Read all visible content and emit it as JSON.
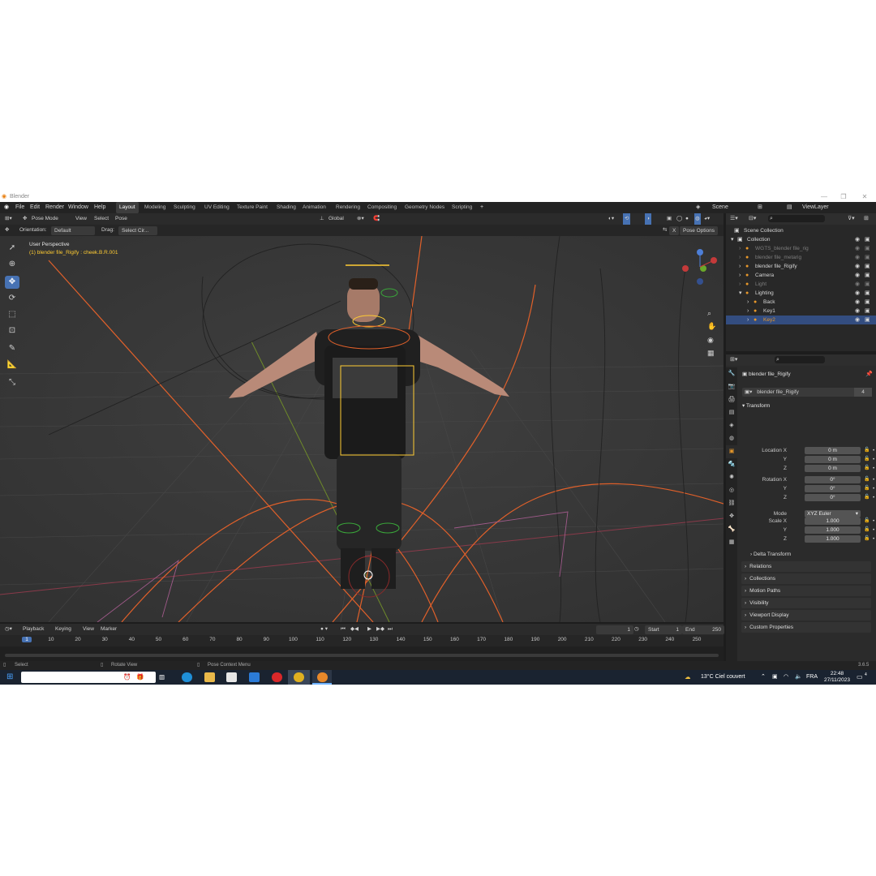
{
  "window": {
    "title": "Blender"
  },
  "menu": {
    "items": [
      "File",
      "Edit",
      "Render",
      "Window",
      "Help"
    ],
    "workspaces": [
      "Layout",
      "Modeling",
      "Sculpting",
      "UV Editing",
      "Texture Paint",
      "Shading",
      "Animation",
      "Rendering",
      "Compositing",
      "Geometry Nodes",
      "Scripting"
    ],
    "add_tab": "+",
    "scene": "Scene",
    "view_layer": "ViewLayer"
  },
  "viewport_header": {
    "mode": "Pose Mode",
    "view": "View",
    "select": "Select",
    "pose": "Pose",
    "transform": "Global"
  },
  "tool_header": {
    "orientation_label": "Orientation:",
    "orientation_value": "Default",
    "drag_label": "Drag:",
    "drag_value": "Select Cir...",
    "x_label": "X",
    "pose_options": "Pose Options"
  },
  "viewport": {
    "perspective": "User Perspective",
    "selection": "(1) blender file_Rigify : cheek.B.R.001"
  },
  "outliner": {
    "root": "Scene Collection",
    "items": [
      {
        "label": "Collection",
        "level": 0,
        "state": "normal"
      },
      {
        "label": "WGTS_blender file_rig",
        "level": 1,
        "state": "grey"
      },
      {
        "label": "blender file_metarig",
        "level": 1,
        "state": "grey"
      },
      {
        "label": "blender file_Rigify",
        "level": 1,
        "state": "normal"
      },
      {
        "label": "Camera",
        "level": 1,
        "state": "normal"
      },
      {
        "label": "Light",
        "level": 1,
        "state": "grey"
      },
      {
        "label": "Lighting",
        "level": 1,
        "state": "normal"
      },
      {
        "label": "Back",
        "level": 2,
        "state": "normal"
      },
      {
        "label": "Key1",
        "level": 2,
        "state": "normal"
      },
      {
        "label": "Key2",
        "level": 2,
        "state": "selected"
      }
    ]
  },
  "properties": {
    "object_name": "blender file_Rigify",
    "data_name": "blender file_Rigify",
    "users": "4",
    "transform_title": "Transform",
    "location": [
      {
        "label": "Location X",
        "value": "0 m"
      },
      {
        "label": "Y",
        "value": "0 m"
      },
      {
        "label": "Z",
        "value": "0 m"
      }
    ],
    "rotation": [
      {
        "label": "Rotation X",
        "value": "0°"
      },
      {
        "label": "Y",
        "value": "0°"
      },
      {
        "label": "Z",
        "value": "0°"
      }
    ],
    "mode_label": "Mode",
    "mode_value": "XYZ Euler",
    "scale": [
      {
        "label": "Scale X",
        "value": "1.000"
      },
      {
        "label": "Y",
        "value": "1.000"
      },
      {
        "label": "Z",
        "value": "1.000"
      }
    ],
    "delta_transform": "Delta Transform",
    "sections": [
      "Relations",
      "Collections",
      "Motion Paths",
      "Visibility",
      "Viewport Display",
      "Custom Properties"
    ]
  },
  "timeline": {
    "playback": "Playback",
    "keying": "Keying",
    "view": "View",
    "marker": "Marker",
    "current_frame": "1",
    "start_label": "Start",
    "start_value": "1",
    "end_label": "End",
    "end_value": "250",
    "ruler_marks": [
      "1",
      "10",
      "20",
      "30",
      "40",
      "50",
      "60",
      "70",
      "80",
      "90",
      "100",
      "110",
      "120",
      "130",
      "140",
      "150",
      "160",
      "170",
      "180",
      "190",
      "200",
      "210",
      "220",
      "230",
      "240",
      "250"
    ]
  },
  "status_bar": {
    "select": "Select",
    "rotate_view": "Rotate View",
    "context_menu": "Pose Context Menu",
    "version": "3.6.5"
  },
  "taskbar": {
    "search_placeholder": "Taper ici pour rechercher",
    "weather": "13°C Ciel couvert",
    "language": "FRA",
    "time": "22:48",
    "date": "27/11/2023",
    "notifications": "4"
  },
  "colors": {
    "accent": "#4772b3",
    "selection": "#334d80",
    "viewport_bg": "#3a3a3a",
    "bone_orange": "#e8622a",
    "active_text": "#ffcc33"
  }
}
